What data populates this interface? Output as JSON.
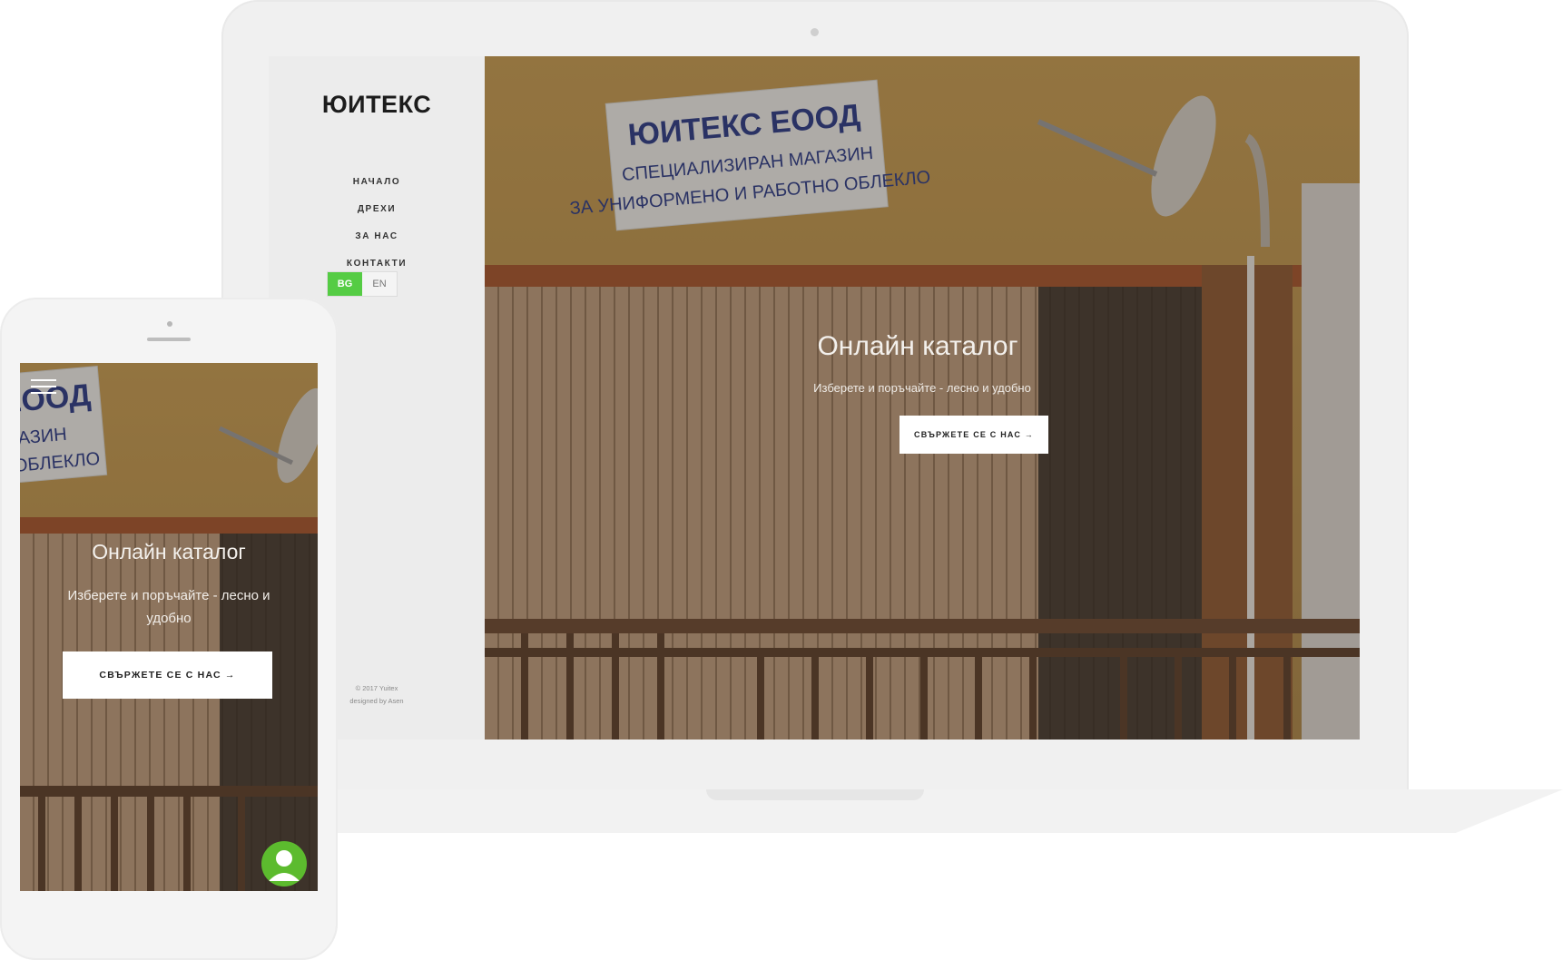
{
  "desktop": {
    "brand": "ЮИТЕКС",
    "nav": [
      "НАЧАЛО",
      "ДРЕХИ",
      "ЗА НАС",
      "КОНТАКТИ"
    ],
    "lang": {
      "active": "BG",
      "inactive": "EN"
    },
    "footer": {
      "copyright": "© 2017 Yuitex",
      "credit": "designed by Asen"
    },
    "hero": {
      "title": "Онлайн каталог",
      "subtitle": "Изберете и поръчайте - лесно и удобно",
      "cta": "СВЪРЖЕТЕ СЕ С НАС →"
    }
  },
  "mobile": {
    "hero": {
      "title": "Онлайн каталог",
      "subtitle": "Изберете и поръчайте - лесно и удобно",
      "cta": "СВЪРЖЕТЕ СЕ С НАС →"
    }
  },
  "photo_sign": {
    "line1": "ЮИТЕКС ЕООД",
    "line2": "СПЕЦИАЛИЗИРАН МАГАЗИН",
    "line3": "ЗА УНИФОРМЕНО И РАБОТНО ОБЛЕКЛО"
  },
  "mobile_sign": {
    "line1": "ЕООД",
    "line2": "МАГАЗИН",
    "line3": "ТНО ОБЛЕКЛО"
  },
  "icons": {
    "menu": "hamburger-icon",
    "chat": "user-avatar-icon"
  },
  "colors": {
    "accent": "#55cc44",
    "chat": "#5cbb2e",
    "wall": "#b58f4d"
  }
}
